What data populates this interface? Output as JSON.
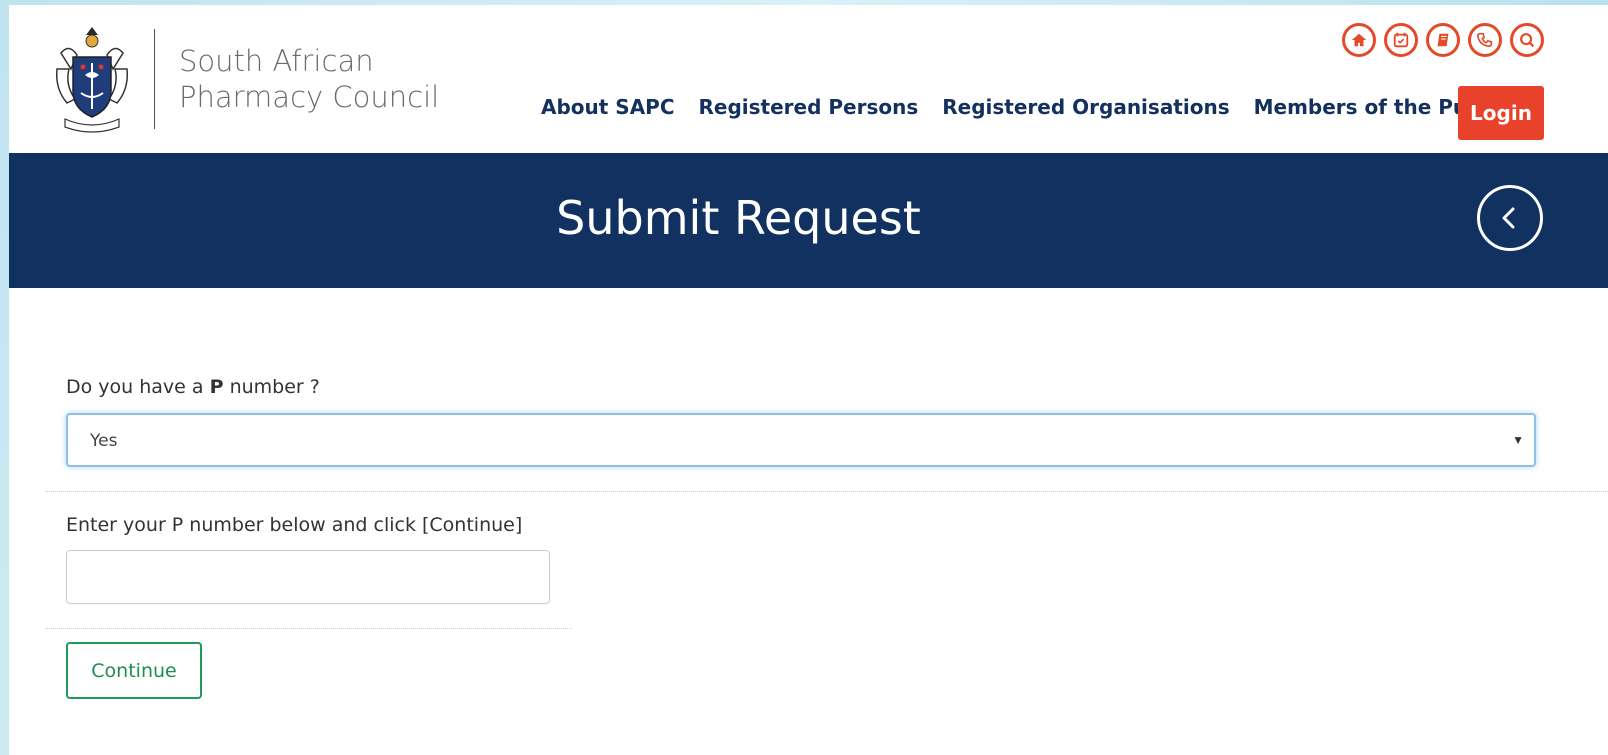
{
  "brand": {
    "name_line1": "South African",
    "name_line2": "Pharmacy Council"
  },
  "utility_icons": [
    "home-icon",
    "calendar-icon",
    "book-icon",
    "phone-icon",
    "search-icon"
  ],
  "nav": {
    "items": [
      {
        "label": "About SAPC"
      },
      {
        "label": "Registered Persons"
      },
      {
        "label": "Registered Organisations"
      },
      {
        "label": "Members of the Public"
      }
    ],
    "login_label": "Login"
  },
  "banner": {
    "title": "Submit Request"
  },
  "form": {
    "question_prefix": "Do you have a ",
    "question_bold": "P",
    "question_suffix": " number ?",
    "select_value": "Yes",
    "p_number_label": "Enter your P number below and click [Continue]",
    "p_number_value": "",
    "continue_label": "Continue"
  },
  "colors": {
    "accent": "#e8422a",
    "navy": "#113260",
    "continue_green": "#1e9a5a"
  }
}
